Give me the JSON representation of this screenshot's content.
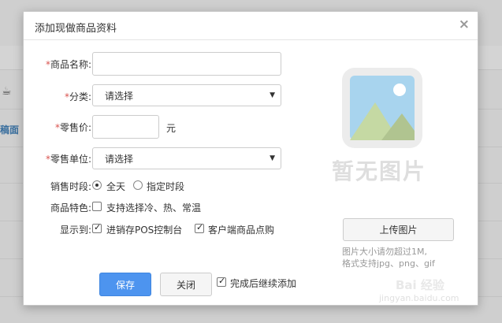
{
  "dialog": {
    "title": "添加现做商品资料",
    "close_glyph": "×"
  },
  "form": {
    "name_label": "商品名称:",
    "name_value": "",
    "category_label": "分类:",
    "category_value": "请选择",
    "price_label": "零售价:",
    "price_value": "",
    "price_unit": "元",
    "sale_unit_label": "零售单位:",
    "sale_unit_value": "请选择",
    "sale_time_label": "销售时段:",
    "sale_time_options": [
      "全天",
      "指定时段"
    ],
    "sale_time_selected": "全天",
    "feature_label": "商品特色:",
    "feature_option": "支持选择冷、热、常温",
    "feature_checked": false,
    "display_label": "显示到:",
    "display_options": [
      "进销存POS控制台",
      "客户端商品点购"
    ],
    "display_checked": [
      true,
      true
    ],
    "required_mark": "*"
  },
  "image": {
    "placeholder_text": "暂无图片",
    "upload_label": "上传图片",
    "hint_line1": "图片大小请勿超过1M,",
    "hint_line2": "格式支持jpg、png、gif"
  },
  "footer": {
    "save_label": "保存",
    "close_label": "关闭",
    "continue_label": "完成后继续添加",
    "continue_checked": true
  },
  "background": {
    "link_text": "稿面",
    "icon": "cup-icon"
  },
  "watermark": {
    "line1": "Bai 经验",
    "line2": "jingyan.baidu.com"
  },
  "colors": {
    "primary": "#4d94ef",
    "required": "#d9534f",
    "image_frame": "#eaeaea",
    "image_sky": "#a8d4ee",
    "image_mountain": "#c8dca8"
  }
}
